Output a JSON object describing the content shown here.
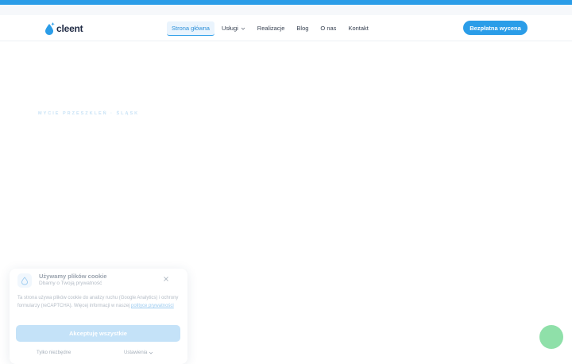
{
  "header": {
    "logo_text": "cleent",
    "nav": [
      {
        "label": "Strona główna",
        "active": true
      },
      {
        "label": "Usługi",
        "has_dropdown": true
      },
      {
        "label": "Realizacje"
      },
      {
        "label": "Blog"
      },
      {
        "label": "O nas"
      },
      {
        "label": "Kontakt"
      }
    ],
    "cta_label": "Bezpłatna wycena"
  },
  "hero": {
    "eyebrow": "MYCIE PRZESZKLEŃ · ŚLĄSK"
  },
  "cookie": {
    "title": "Używamy plików cookie",
    "subtitle": "Dbamy o Twoją prywatność",
    "text": "Ta strona używa plików cookie do analizy ruchu (Google Analytics) i ochrony formularzy (reCAPTCHA). Więcej informacji w naszej",
    "link_text": "polityce prywatności",
    "accept_label": "Akceptuję wszystkie",
    "necessary_label": "Tylko niezbędne",
    "settings_label": "Ustawienia"
  },
  "colors": {
    "accent": "#2b9de8",
    "fab": "#8fe0a9"
  }
}
